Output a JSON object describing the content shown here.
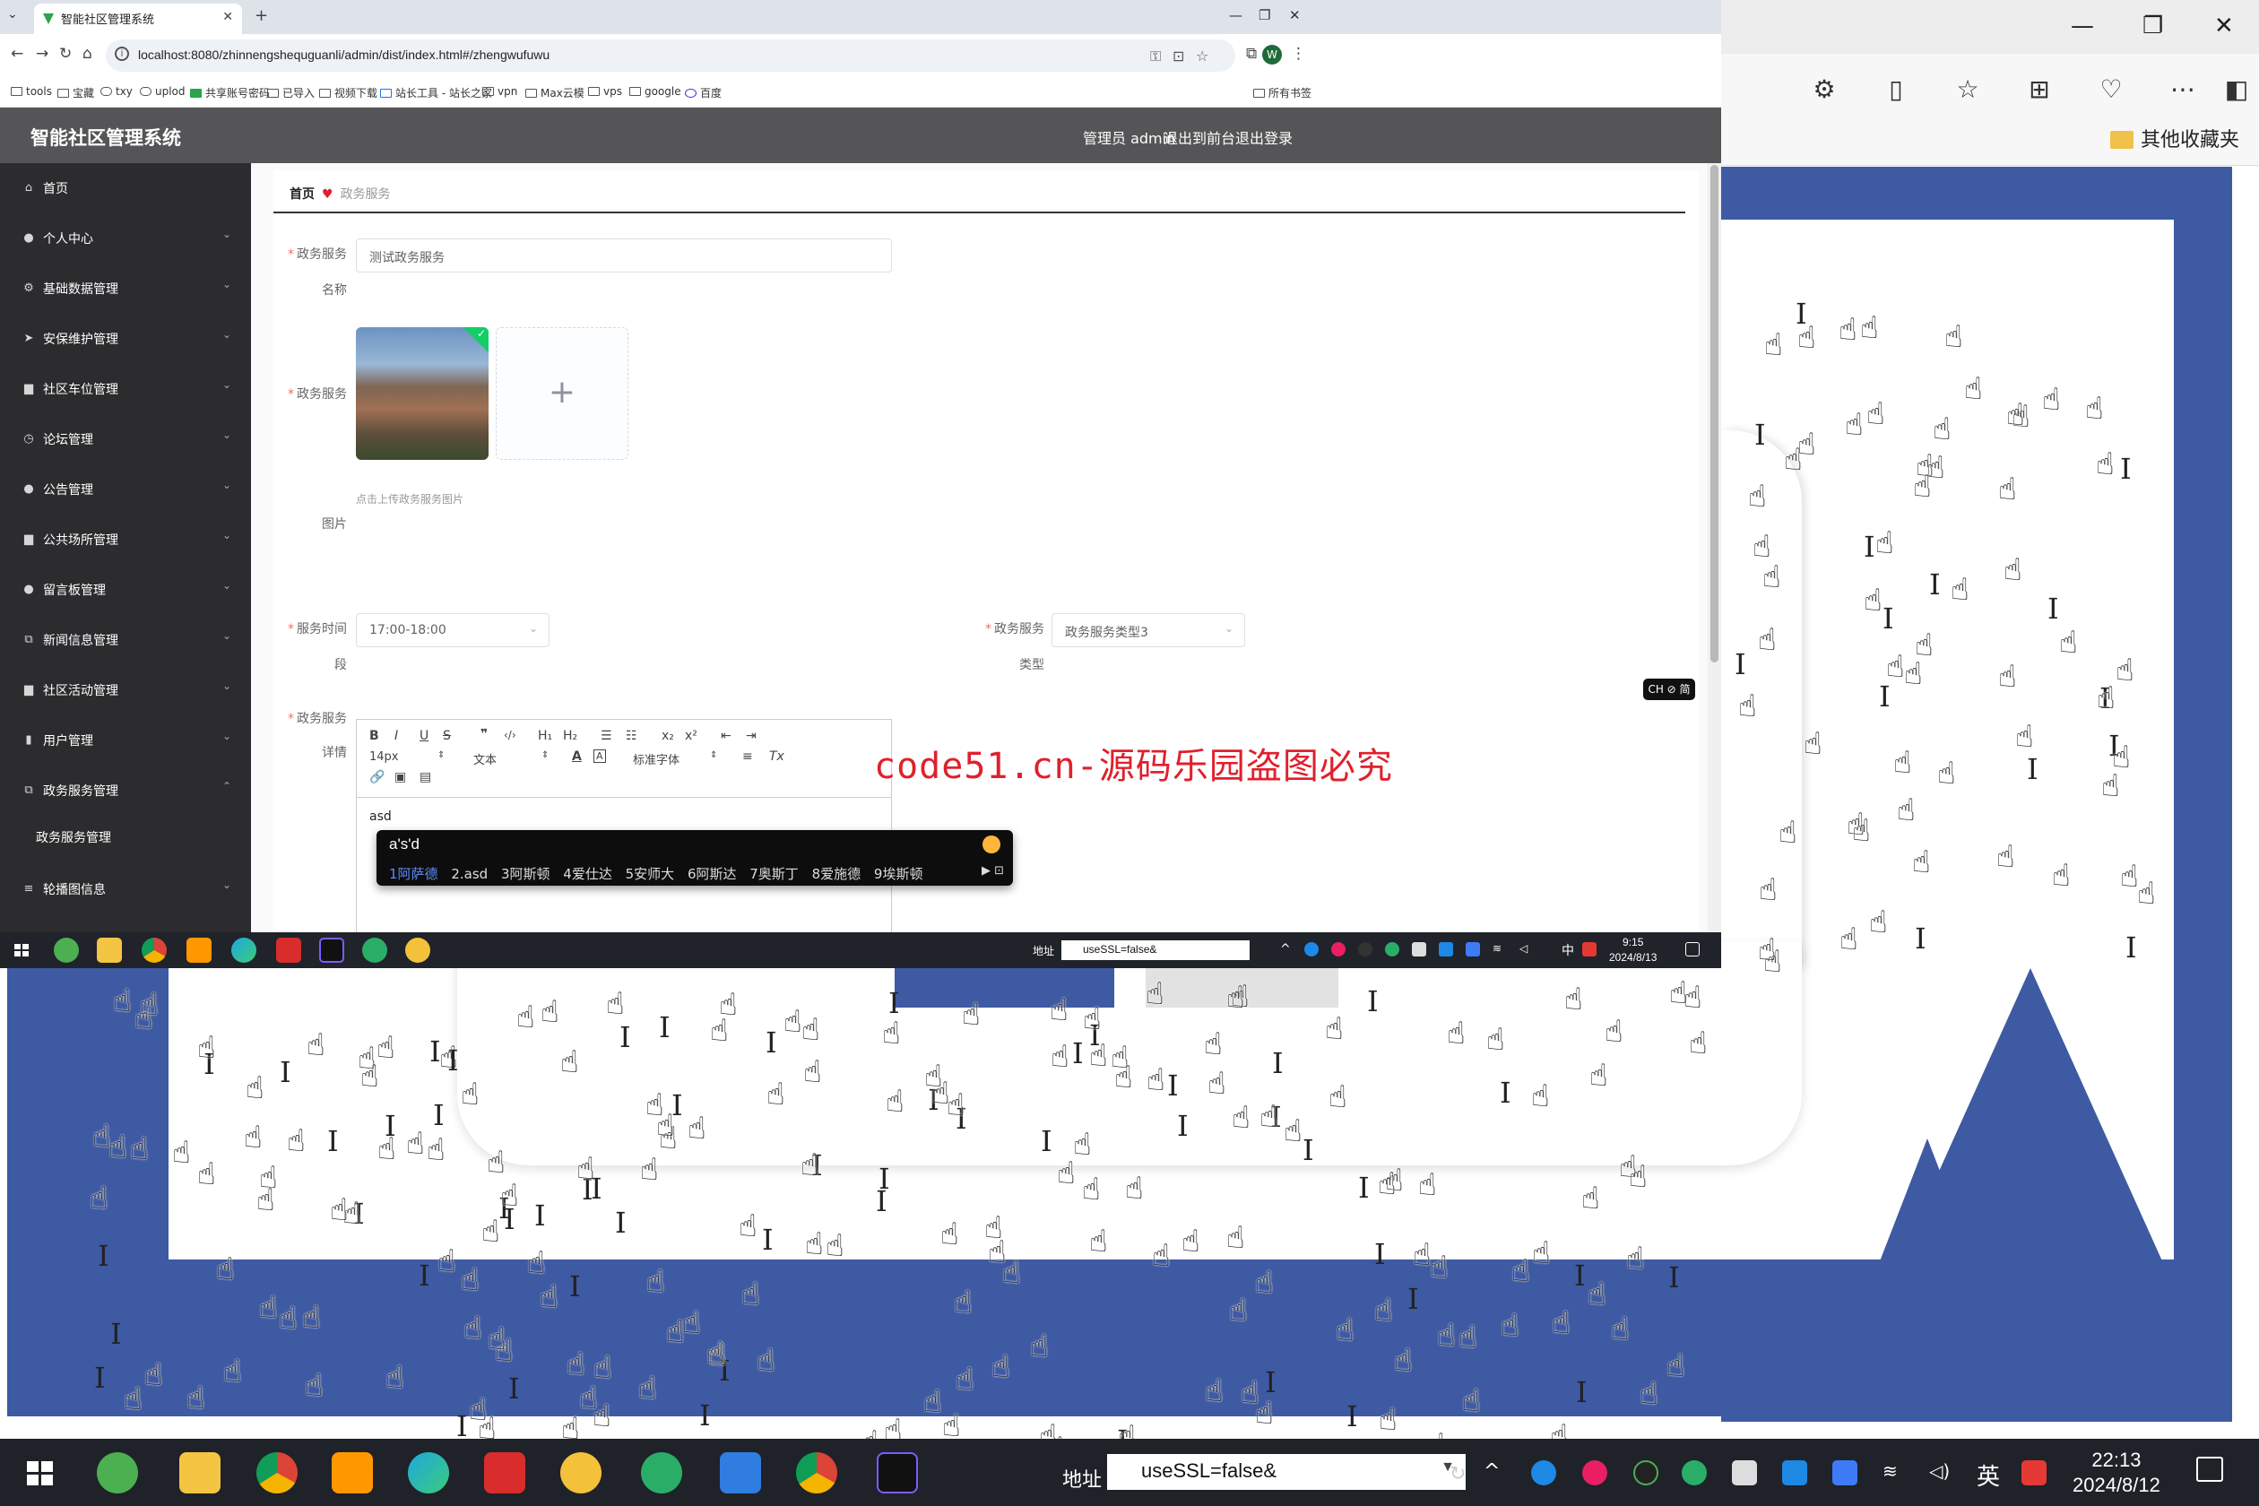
{
  "background_browser": {
    "favorites_label": "其他收藏夹"
  },
  "host_taskbar": {
    "address_label": "地址",
    "address_value": "useSSL=false&",
    "ime": "英",
    "time": "22:13",
    "date": "2024/8/12"
  },
  "browser": {
    "tab_title": "智能社区管理系统",
    "url": "localhost:8080/zhinnengshequguanli/admin/dist/index.html#/zhengwufuwu",
    "bookmarks": [
      "tools",
      "宝藏",
      "txy",
      "uplod",
      "共享账号密码",
      "已导入",
      "视频下载",
      "站长工具 - 站长之家",
      "vpn",
      "Max云模",
      "vps",
      "google",
      "百度"
    ],
    "bookmarks_right": "所有书签",
    "profile_initial": "W"
  },
  "app": {
    "title": "智能社区管理系统",
    "nav": [
      "管理员 admin",
      "退出到前台",
      "退出登录"
    ]
  },
  "sidebar": {
    "items": [
      {
        "label": "首页",
        "icon": "home-icon"
      },
      {
        "label": "个人中心",
        "icon": "user-icon"
      },
      {
        "label": "基础数据管理",
        "icon": "settings-icon"
      },
      {
        "label": "安保维护管理",
        "icon": "send-icon"
      },
      {
        "label": "社区车位管理",
        "icon": "monitor-icon"
      },
      {
        "label": "论坛管理",
        "icon": "clock-icon"
      },
      {
        "label": "公告管理",
        "icon": "user-icon"
      },
      {
        "label": "公共场所管理",
        "icon": "monitor-icon"
      },
      {
        "label": "留言板管理",
        "icon": "user-icon"
      },
      {
        "label": "新闻信息管理",
        "icon": "copy-icon"
      },
      {
        "label": "社区活动管理",
        "icon": "monitor-icon"
      },
      {
        "label": "用户管理",
        "icon": "bar-chart-icon"
      },
      {
        "label": "政务服务管理",
        "icon": "copy-icon"
      }
    ],
    "sub_item": "政务服务管理",
    "last_item": "轮播图信息"
  },
  "breadcrumb": {
    "home": "首页",
    "current": "政务服务"
  },
  "form": {
    "name_label_1": "政务服务",
    "name_label_2": "名称",
    "name_value": "测试政务服务",
    "image_label_1": "政务服务",
    "image_label_2": "图片",
    "upload_tip": "点击上传政务服务图片",
    "time_label_1": "服务时间",
    "time_label_2": "段",
    "time_value": "17:00-18:00",
    "type_label_1": "政务服务",
    "type_label_2": "类型",
    "type_value": "政务服务类型3",
    "detail_label_1": "政务服务",
    "detail_label_2": "详情",
    "editor_font_size": "14px",
    "editor_block": "文本",
    "editor_font": "标准字体",
    "editor_content": "asd"
  },
  "watermark": "code51.cn-源码乐园盗图必究",
  "ime_badge": "CH ⊘ 简",
  "ime_popup": {
    "input": "a's'd",
    "candidates": [
      "1阿萨德",
      "2.asd",
      "3阿斯顿",
      "4爱仕达",
      "5安师大",
      "6阿斯达",
      "7奥斯丁",
      "8爱施德",
      "9埃斯顿"
    ]
  },
  "inner_taskbar": {
    "address_label": "地址",
    "address_value": "useSSL=false&",
    "ime": "中",
    "time": "9:15",
    "date": "2024/8/13"
  }
}
